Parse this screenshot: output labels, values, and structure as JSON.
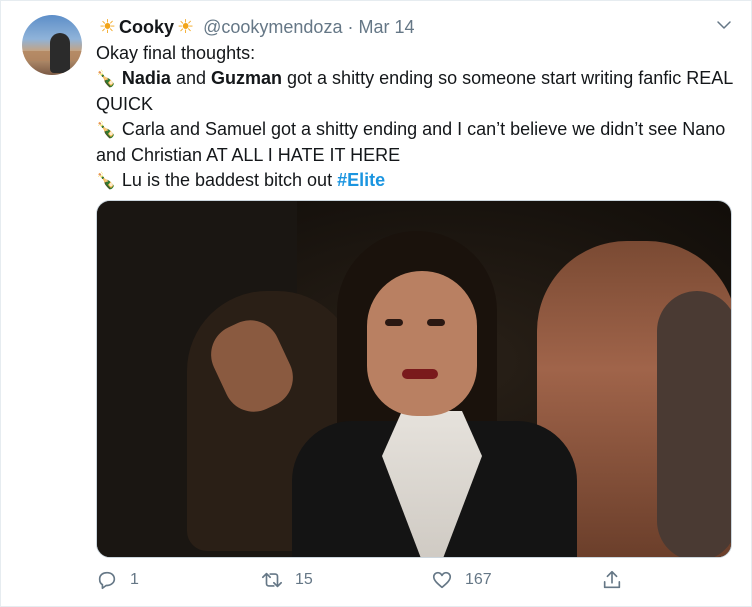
{
  "header": {
    "name": "Cooky",
    "handle": "@cookymendoza",
    "separator": "·",
    "date": "Mar 14"
  },
  "body": {
    "line1": "Okay final thoughts:",
    "p1_name1": "Nadia",
    "p1_and": " and ",
    "p1_name2": "Guzman",
    "p1_rest": " got a shitty ending so someone start writing fanfic REAL QUICK",
    "p2": "Carla and Samuel got a shitty ending and I can’t believe we didn’t see Nano and Christian AT ALL I HATE IT HERE",
    "p3": "Lu is the baddest bitch out ",
    "hashtag": "#Elite"
  },
  "actions": {
    "reply_count": "1",
    "retweet_count": "15",
    "like_count": "167"
  },
  "icons": {
    "sun": "☀",
    "bottle": "🍾"
  },
  "colors": {
    "link": "#1b95e0",
    "muted": "#657786",
    "sun": "#f2a51a"
  }
}
